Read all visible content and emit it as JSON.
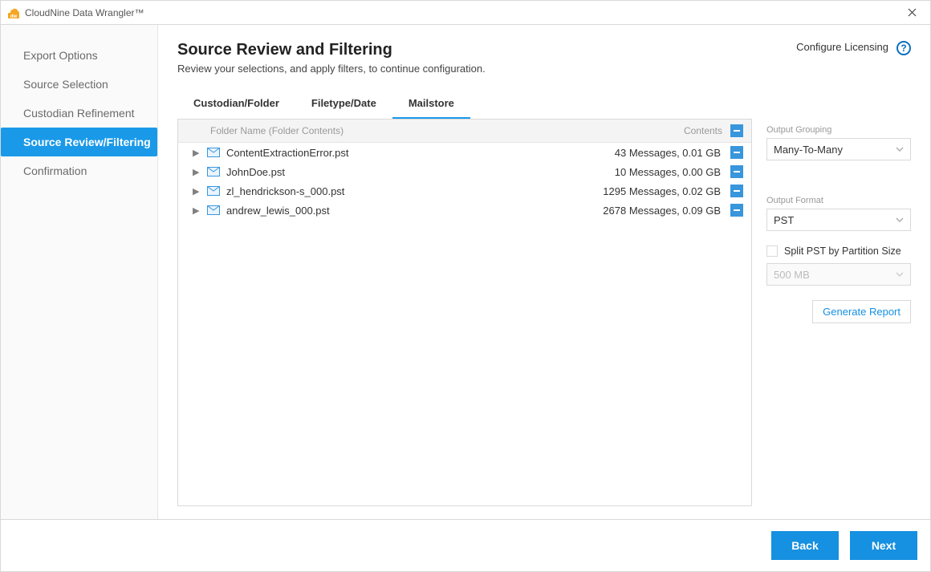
{
  "window": {
    "title": "CloudNine Data Wrangler™"
  },
  "sidebar": {
    "steps": [
      {
        "label": "Export Options",
        "active": false
      },
      {
        "label": "Source Selection",
        "active": false
      },
      {
        "label": "Custodian Refinement",
        "active": false
      },
      {
        "label": "Source Review/Filtering",
        "active": true
      },
      {
        "label": "Confirmation",
        "active": false
      }
    ]
  },
  "header": {
    "title": "Source Review and Filtering",
    "subtitle": "Review your selections, and apply filters, to continue configuration.",
    "configure": "Configure Licensing",
    "help": "?"
  },
  "tabs": [
    {
      "label": "Custodian/Folder",
      "active": false
    },
    {
      "label": "Filetype/Date",
      "active": false
    },
    {
      "label": "Mailstore",
      "active": true
    }
  ],
  "table": {
    "col_folder": "Folder Name (Folder Contents)",
    "col_contents": "Contents",
    "rows": [
      {
        "name": "ContentExtractionError.pst",
        "contents": "43 Messages, 0.01 GB"
      },
      {
        "name": "JohnDoe.pst",
        "contents": "10 Messages, 0.00 GB"
      },
      {
        "name": "zl_hendrickson-s_000.pst",
        "contents": "1295 Messages, 0.02 GB"
      },
      {
        "name": "andrew_lewis_000.pst",
        "contents": "2678 Messages, 0.09 GB"
      }
    ]
  },
  "options": {
    "grouping_label": "Output Grouping",
    "grouping_value": "Many-To-Many",
    "format_label": "Output Format",
    "format_value": "PST",
    "split_label": "Split PST by Partition Size",
    "split_checked": false,
    "partition_value": "500 MB",
    "generate_report": "Generate Report"
  },
  "footer": {
    "back": "Back",
    "next": "Next"
  }
}
